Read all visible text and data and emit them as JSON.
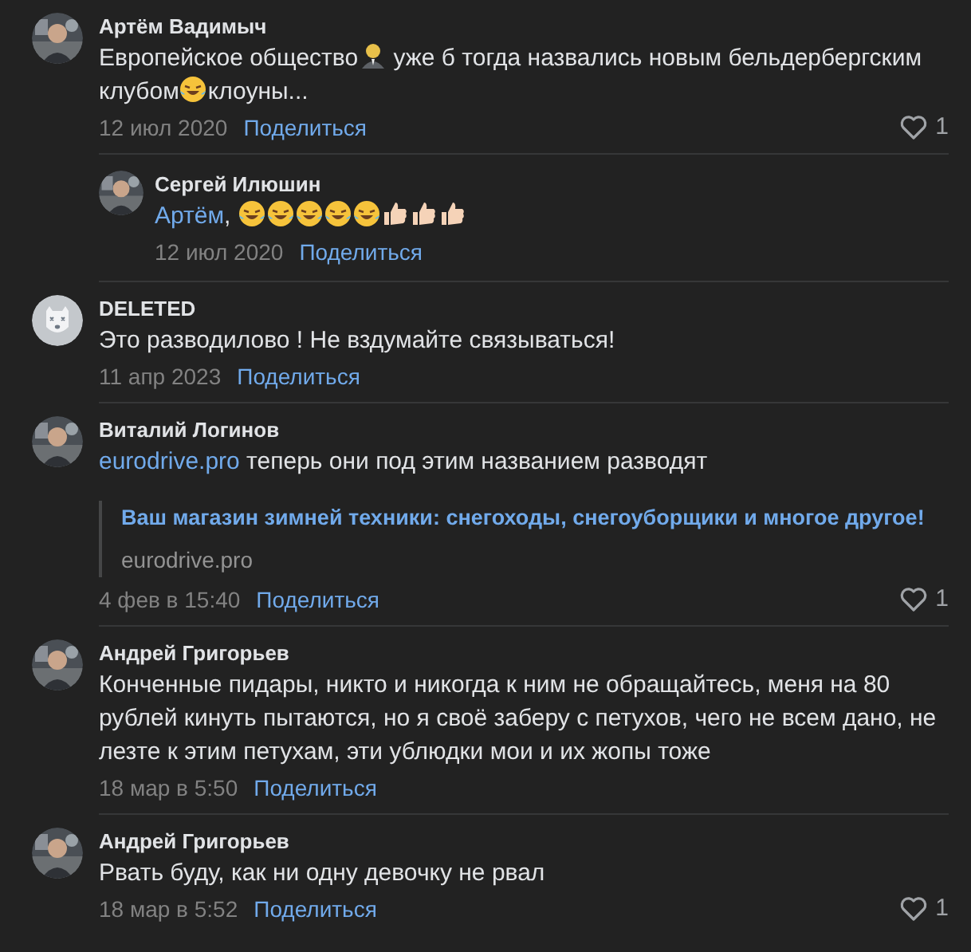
{
  "comments": [
    {
      "author": "Артём Вадимыч",
      "avatar": {
        "kind": "picture"
      },
      "parts": [
        {
          "kind": "text",
          "text": "Европейское общество"
        },
        {
          "kind": "person-emoji"
        },
        {
          "kind": "text",
          "text": " уже б тогда назвались новым бельдербергским"
        },
        {
          "kind": "text",
          "text": "клубом"
        },
        {
          "kind": "laugh-emoji"
        },
        {
          "kind": "text",
          "text": "клоуны..."
        }
      ],
      "date": "12 июл 2020",
      "share": "Поделиться",
      "likes": "1",
      "replies": [
        {
          "author": "Сергей Илюшин",
          "avatar": {
            "kind": "picture"
          },
          "parts": [
            {
              "kind": "link",
              "text": "Артём"
            },
            {
              "kind": "text",
              "text": ", "
            },
            {
              "kind": "laugh-emoji"
            },
            {
              "kind": "laugh-emoji"
            },
            {
              "kind": "laugh-emoji"
            },
            {
              "kind": "laugh-emoji"
            },
            {
              "kind": "laugh-emoji"
            },
            {
              "kind": "thumb-emoji"
            },
            {
              "kind": "thumb-emoji"
            },
            {
              "kind": "thumb-emoji"
            }
          ],
          "date": "12 июл 2020",
          "share": "Поделиться"
        }
      ]
    },
    {
      "author": "DELETED",
      "avatar": {
        "kind": "deleted"
      },
      "parts": [
        {
          "kind": "text",
          "text": "Это разводилово ! Не вздумайте связываться!"
        }
      ],
      "date": "11 апр 2023",
      "share": "Поделиться"
    },
    {
      "author": "Виталий Логинов",
      "avatar": {
        "kind": "picture"
      },
      "parts": [
        {
          "kind": "link",
          "text": "eurodrive.pro"
        },
        {
          "kind": "text",
          "text": " теперь они под этим названием разводят"
        }
      ],
      "preview": {
        "title": "Ваш магазин зимней техники: снегоходы, снегоуборщики и многое другое!",
        "domain": "eurodrive.pro"
      },
      "date": "4 фев в 15:40",
      "share": "Поделиться",
      "likes": "1"
    },
    {
      "author": "Андрей Григорьев",
      "avatar": {
        "kind": "picture"
      },
      "parts": [
        {
          "kind": "text",
          "text": "Конченные пидары, никто и никогда к ним не обращайтесь, меня на 80 рублей кинуть пытаются, но я своё заберу с петухов, чего не всем дано, не лезте к этим петухам, эти ублюдки мои и их жопы тоже"
        }
      ],
      "date": "18 мар в 5:50",
      "share": "Поделиться"
    },
    {
      "author": "Андрей Григорьев",
      "avatar": {
        "kind": "picture"
      },
      "parts": [
        {
          "kind": "text",
          "text": "Рвать буду, как ни одну девочку не рвал"
        }
      ],
      "date": "18 мар в 5:52",
      "share": "Поделиться",
      "likes": "1"
    }
  ]
}
